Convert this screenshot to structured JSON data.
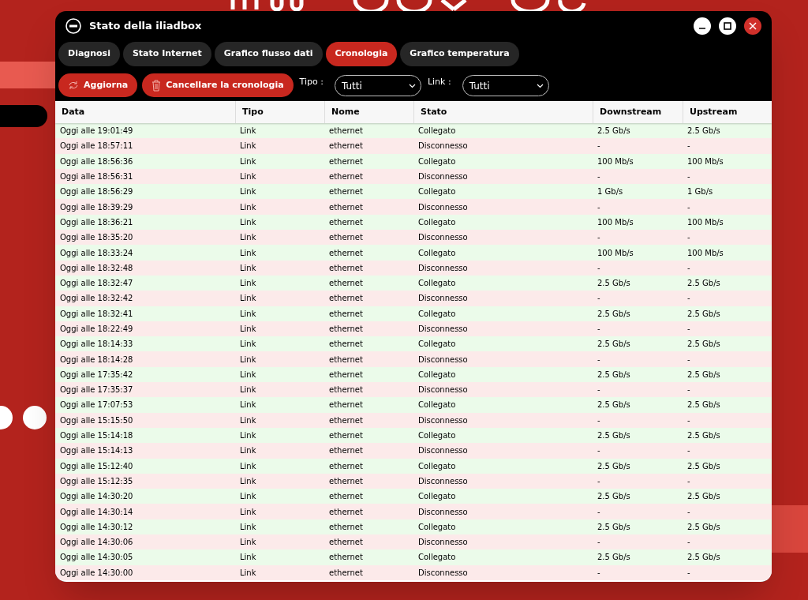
{
  "window": {
    "title": "Stato della iliadbox"
  },
  "tabs": [
    {
      "label": "Diagnosi",
      "selected": false
    },
    {
      "label": "Stato Internet",
      "selected": false
    },
    {
      "label": "Grafico flusso dati",
      "selected": false
    },
    {
      "label": "Cronologia",
      "selected": true
    },
    {
      "label": "Grafico temperatura",
      "selected": false
    }
  ],
  "toolbar": {
    "refresh": "Aggiorna",
    "clear": "Cancellare la cronologia",
    "filters": [
      {
        "label": "Tipo :",
        "value": "Tutti"
      },
      {
        "label": "Link :",
        "value": "Tutti"
      }
    ]
  },
  "table": {
    "columns": [
      "Data",
      "Tipo",
      "Nome",
      "Stato",
      "Downstream",
      "Upstream"
    ],
    "rows": [
      {
        "cells": [
          "Oggi alle 19:01:49",
          "Link",
          "ethernet",
          "Collegato",
          "2.5 Gb/s",
          "2.5 Gb/s"
        ],
        "connected": true
      },
      {
        "cells": [
          "Oggi alle 18:57:11",
          "Link",
          "ethernet",
          "Disconnesso",
          "-",
          "-"
        ],
        "connected": false
      },
      {
        "cells": [
          "Oggi alle 18:56:36",
          "Link",
          "ethernet",
          "Collegato",
          "100 Mb/s",
          "100 Mb/s"
        ],
        "connected": true
      },
      {
        "cells": [
          "Oggi alle 18:56:31",
          "Link",
          "ethernet",
          "Disconnesso",
          "-",
          "-"
        ],
        "connected": false
      },
      {
        "cells": [
          "Oggi alle 18:56:29",
          "Link",
          "ethernet",
          "Collegato",
          "1 Gb/s",
          "1 Gb/s"
        ],
        "connected": true
      },
      {
        "cells": [
          "Oggi alle 18:39:29",
          "Link",
          "ethernet",
          "Disconnesso",
          "-",
          "-"
        ],
        "connected": false
      },
      {
        "cells": [
          "Oggi alle 18:36:21",
          "Link",
          "ethernet",
          "Collegato",
          "100 Mb/s",
          "100 Mb/s"
        ],
        "connected": true
      },
      {
        "cells": [
          "Oggi alle 18:35:20",
          "Link",
          "ethernet",
          "Disconnesso",
          "-",
          "-"
        ],
        "connected": false
      },
      {
        "cells": [
          "Oggi alle 18:33:24",
          "Link",
          "ethernet",
          "Collegato",
          "100 Mb/s",
          "100 Mb/s"
        ],
        "connected": true
      },
      {
        "cells": [
          "Oggi alle 18:32:48",
          "Link",
          "ethernet",
          "Disconnesso",
          "-",
          "-"
        ],
        "connected": false
      },
      {
        "cells": [
          "Oggi alle 18:32:47",
          "Link",
          "ethernet",
          "Collegato",
          "2.5 Gb/s",
          "2.5 Gb/s"
        ],
        "connected": true
      },
      {
        "cells": [
          "Oggi alle 18:32:42",
          "Link",
          "ethernet",
          "Disconnesso",
          "-",
          "-"
        ],
        "connected": false
      },
      {
        "cells": [
          "Oggi alle 18:32:41",
          "Link",
          "ethernet",
          "Collegato",
          "2.5 Gb/s",
          "2.5 Gb/s"
        ],
        "connected": true
      },
      {
        "cells": [
          "Oggi alle 18:22:49",
          "Link",
          "ethernet",
          "Disconnesso",
          "-",
          "-"
        ],
        "connected": false
      },
      {
        "cells": [
          "Oggi alle 18:14:33",
          "Link",
          "ethernet",
          "Collegato",
          "2.5 Gb/s",
          "2.5 Gb/s"
        ],
        "connected": true
      },
      {
        "cells": [
          "Oggi alle 18:14:28",
          "Link",
          "ethernet",
          "Disconnesso",
          "-",
          "-"
        ],
        "connected": false
      },
      {
        "cells": [
          "Oggi alle 17:35:42",
          "Link",
          "ethernet",
          "Collegato",
          "2.5 Gb/s",
          "2.5 Gb/s"
        ],
        "connected": true
      },
      {
        "cells": [
          "Oggi alle 17:35:37",
          "Link",
          "ethernet",
          "Disconnesso",
          "-",
          "-"
        ],
        "connected": false
      },
      {
        "cells": [
          "Oggi alle 17:07:53",
          "Link",
          "ethernet",
          "Collegato",
          "2.5 Gb/s",
          "2.5 Gb/s"
        ],
        "connected": true
      },
      {
        "cells": [
          "Oggi alle 15:15:50",
          "Link",
          "ethernet",
          "Disconnesso",
          "-",
          "-"
        ],
        "connected": false
      },
      {
        "cells": [
          "Oggi alle 15:14:18",
          "Link",
          "ethernet",
          "Collegato",
          "2.5 Gb/s",
          "2.5 Gb/s"
        ],
        "connected": true
      },
      {
        "cells": [
          "Oggi alle 15:14:13",
          "Link",
          "ethernet",
          "Disconnesso",
          "-",
          "-"
        ],
        "connected": false
      },
      {
        "cells": [
          "Oggi alle 15:12:40",
          "Link",
          "ethernet",
          "Collegato",
          "2.5 Gb/s",
          "2.5 Gb/s"
        ],
        "connected": true
      },
      {
        "cells": [
          "Oggi alle 15:12:35",
          "Link",
          "ethernet",
          "Disconnesso",
          "-",
          "-"
        ],
        "connected": false
      },
      {
        "cells": [
          "Oggi alle 14:30:20",
          "Link",
          "ethernet",
          "Collegato",
          "2.5 Gb/s",
          "2.5 Gb/s"
        ],
        "connected": true
      },
      {
        "cells": [
          "Oggi alle 14:30:14",
          "Link",
          "ethernet",
          "Disconnesso",
          "-",
          "-"
        ],
        "connected": false
      },
      {
        "cells": [
          "Oggi alle 14:30:12",
          "Link",
          "ethernet",
          "Collegato",
          "2.5 Gb/s",
          "2.5 Gb/s"
        ],
        "connected": true
      },
      {
        "cells": [
          "Oggi alle 14:30:06",
          "Link",
          "ethernet",
          "Disconnesso",
          "-",
          "-"
        ],
        "connected": false
      },
      {
        "cells": [
          "Oggi alle 14:30:05",
          "Link",
          "ethernet",
          "Collegato",
          "2.5 Gb/s",
          "2.5 Gb/s"
        ],
        "connected": true
      },
      {
        "cells": [
          "Oggi alle 14:30:00",
          "Link",
          "ethernet",
          "Disconnesso",
          "-",
          "-"
        ],
        "connected": false
      }
    ]
  }
}
